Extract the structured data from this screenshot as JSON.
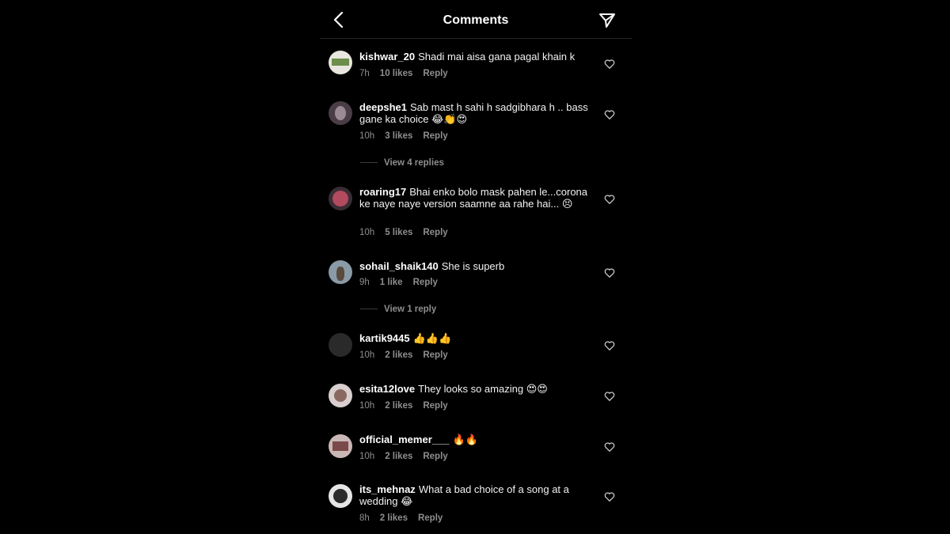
{
  "header": {
    "title": "Comments"
  },
  "comments": [
    {
      "username": "kishwar_20",
      "text": "Shadi mai aisa gana pagal khain k",
      "time": "7h",
      "likes": "10 likes",
      "reply": "Reply"
    },
    {
      "username": "deepshe1",
      "text": "Sab mast h sahi h sadgibhara h .. bass gane ka choice",
      "emoji": "😂👏😍",
      "time": "10h",
      "likes": "3 likes",
      "reply": "Reply",
      "view_replies": "View 4 replies"
    },
    {
      "username": "roaring17",
      "text": "Bhai enko bolo mask pahen le...corona ke naye naye version saamne aa rahe hai...",
      "emoji": "😣",
      "time": "10h",
      "likes": "5 likes",
      "reply": "Reply"
    },
    {
      "username": "sohail_shaik140",
      "text": "She is superb",
      "time": "9h",
      "likes": "1 like",
      "reply": "Reply",
      "view_replies": "View 1 reply"
    },
    {
      "username": "kartik9445",
      "text": "",
      "emoji": "👍👍👍",
      "time": "10h",
      "likes": "2 likes",
      "reply": "Reply"
    },
    {
      "username": "esita12love",
      "text": "They looks so amazing",
      "emoji": "😍😍",
      "time": "10h",
      "likes": "2 likes",
      "reply": "Reply"
    },
    {
      "username": "official_memer___",
      "text": "",
      "emoji": "🔥🔥",
      "time": "10h",
      "likes": "2 likes",
      "reply": "Reply"
    },
    {
      "username": "its_mehnaz",
      "text": "What a bad choice of a song at a wedding",
      "emoji": "😂",
      "time": "8h",
      "likes": "2 likes",
      "reply": "Reply"
    }
  ],
  "colors": {
    "background": "#000000",
    "text": "#ffffff",
    "muted": "#8e8e8e",
    "divider": "#262626"
  }
}
